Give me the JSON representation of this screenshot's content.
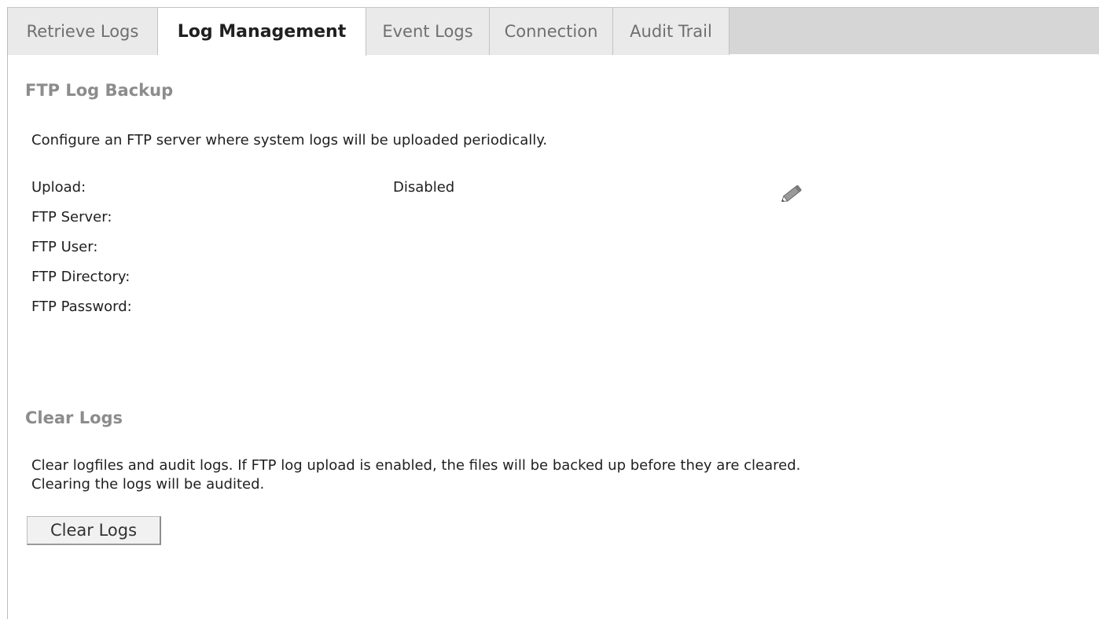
{
  "tabs": [
    {
      "label": "Retrieve Logs",
      "active": false
    },
    {
      "label": "Log Management",
      "active": true
    },
    {
      "label": "Event Logs",
      "active": false
    },
    {
      "label": "Connection",
      "active": false
    },
    {
      "label": "Audit Trail",
      "active": false
    }
  ],
  "ftp_backup": {
    "title": "FTP Log Backup",
    "description": "Configure an FTP server where system logs will be uploaded periodically.",
    "fields": [
      {
        "label": "Upload:",
        "value": "Disabled"
      },
      {
        "label": "FTP Server:",
        "value": ""
      },
      {
        "label": "FTP User:",
        "value": ""
      },
      {
        "label": "FTP Directory:",
        "value": ""
      },
      {
        "label": "FTP Password:",
        "value": ""
      }
    ],
    "edit_icon": "pencil-icon"
  },
  "clear_logs": {
    "title": "Clear Logs",
    "description_line1": "Clear logfiles and audit logs. If FTP log upload is enabled, the files will be backed up before they are cleared.",
    "description_line2": "Clearing the logs will be audited.",
    "button_label": "Clear Logs"
  }
}
